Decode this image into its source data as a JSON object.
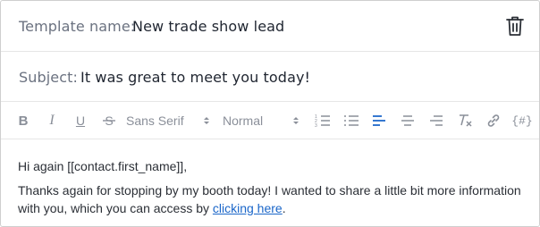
{
  "template_name": {
    "label": "Template name:",
    "value": "New trade show lead"
  },
  "subject": {
    "label": "Subject:",
    "value": "It was great to meet you today!"
  },
  "toolbar": {
    "bold": "B",
    "italic": "I",
    "underline": "U",
    "strike": "S",
    "font_family": "Sans Serif",
    "font_size": "Normal",
    "variable": "{#}",
    "active_color": "#1a66c9",
    "icon_color": "#8a8f99"
  },
  "body": {
    "greeting": "Hi again [[contact.first_name]],",
    "paragraph_text": "Thanks again for stopping by my booth today! I wanted to share a little bit more information with you, which you can access by ",
    "link_text": "clicking here",
    "paragraph_end": "."
  }
}
